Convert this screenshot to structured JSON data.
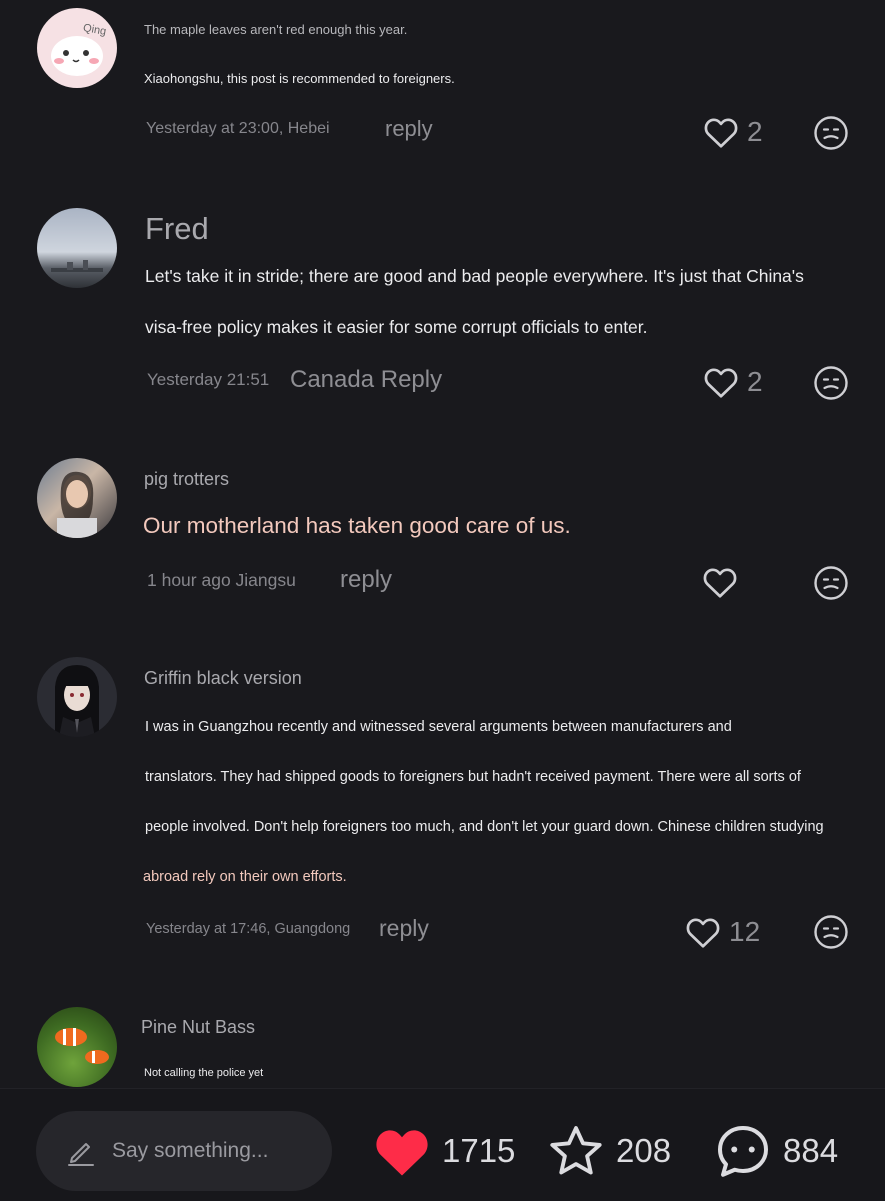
{
  "comments": [
    {
      "name": "",
      "avatar_label": "Qing",
      "lines": [
        "The maple leaves aren't red enough this year.",
        "Xiaohongshu, this post is recommended to foreigners."
      ],
      "meta": "Yesterday at 23:00, Hebei",
      "reply": "reply",
      "likes": "2"
    },
    {
      "name": "Fred",
      "lines": [
        "Let's take it in stride; there are good and bad people everywhere. It's just that China's",
        "visa-free policy makes it easier for some corrupt officials to enter."
      ],
      "meta": "Yesterday 21:51",
      "reply": "Canada Reply",
      "likes": "2"
    },
    {
      "name": "pig trotters",
      "lines": [
        "Our motherland has taken good care of us."
      ],
      "meta": "1 hour ago Jiangsu",
      "reply": "reply",
      "likes": ""
    },
    {
      "name": "Griffin black version",
      "lines": [
        "I was in Guangzhou recently and witnessed several arguments between manufacturers and",
        "translators. They had shipped goods to foreigners but hadn't received payment. There were all sorts of",
        "people involved. Don't help foreigners too much, and don't let your guard down. Chinese children studying",
        "abroad rely on their own efforts."
      ],
      "meta": "Yesterday at 17:46, Guangdong",
      "reply": "reply",
      "likes": "12"
    },
    {
      "name": "Pine Nut Bass",
      "lines": [
        "Not calling the police yet"
      ]
    }
  ],
  "bottom_bar": {
    "placeholder": "Say something...",
    "likes": "1715",
    "stars": "208",
    "comments": "884"
  },
  "colors": {
    "background": "#19191d",
    "heart_accent": "#fe2c48",
    "highlight_text": "#f3c9bd"
  },
  "icons": [
    "heart-outline-icon",
    "emoji-icon",
    "pencil-icon",
    "heart-filled-icon",
    "star-icon",
    "chat-bubble-icon"
  ]
}
